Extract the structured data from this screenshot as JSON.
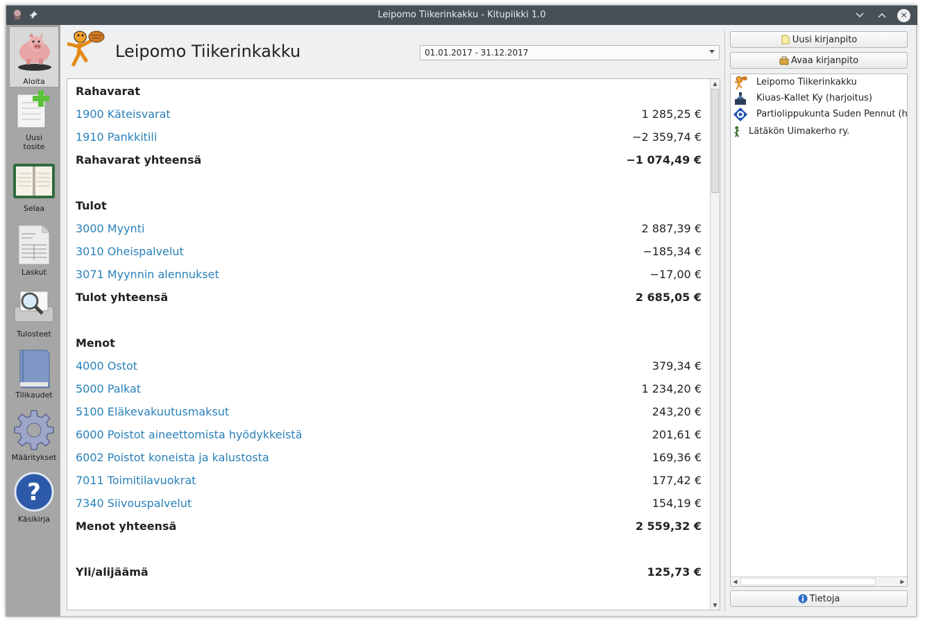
{
  "window": {
    "title": "Leipomo Tiikerinkakku - Kitupiikki 1.0"
  },
  "sidebar": {
    "items": [
      {
        "label": "Aloita",
        "icon": "piggy-bank-icon"
      },
      {
        "label": "Uusi\ntosite",
        "icon": "new-voucher-icon"
      },
      {
        "label": "Selaa",
        "icon": "calendar-book-icon"
      },
      {
        "label": "Laskut",
        "icon": "invoice-icon"
      },
      {
        "label": "Tulosteet",
        "icon": "print-preview-icon"
      },
      {
        "label": "Tilikaudet",
        "icon": "book-icon"
      },
      {
        "label": "Määritykset",
        "icon": "gear-icon"
      },
      {
        "label": "Käsikirja",
        "icon": "help-icon"
      }
    ]
  },
  "header": {
    "company": "Leipomo Tiikerinkakku",
    "period": "01.01.2017 - 31.12.2017"
  },
  "report": {
    "rows": [
      {
        "type": "section",
        "name": "Rahavarat",
        "amount": ""
      },
      {
        "type": "account",
        "name": "1900 Käteisvarat",
        "amount": "1 285,25 €"
      },
      {
        "type": "account",
        "name": "1910 Pankkitili",
        "amount": "−2 359,74 €"
      },
      {
        "type": "total",
        "name": "Rahavarat yhteensä",
        "amount": "−1 074,49 €"
      },
      {
        "type": "section",
        "name": "Tulot",
        "amount": ""
      },
      {
        "type": "account",
        "name": "3000 Myynti",
        "amount": "2 887,39 €"
      },
      {
        "type": "account",
        "name": "3010 Oheispalvelut",
        "amount": "−185,34 €"
      },
      {
        "type": "account",
        "name": "3071 Myynnin alennukset",
        "amount": "−17,00 €"
      },
      {
        "type": "total",
        "name": "Tulot yhteensä",
        "amount": "2 685,05 €"
      },
      {
        "type": "section",
        "name": "Menot",
        "amount": ""
      },
      {
        "type": "account",
        "name": "4000 Ostot",
        "amount": "379,34 €"
      },
      {
        "type": "account",
        "name": "5000 Palkat",
        "amount": "1 234,20 €"
      },
      {
        "type": "account",
        "name": "5100 Eläkevakuutusmaksut",
        "amount": "243,20 €"
      },
      {
        "type": "account",
        "name": "6000 Poistot aineettomista hyödykkeistä",
        "amount": "201,61 €"
      },
      {
        "type": "account",
        "name": "6002 Poistot koneista ja kalustosta",
        "amount": "169,36 €"
      },
      {
        "type": "account",
        "name": "7011 Toimitilavuokrat",
        "amount": "177,42 €"
      },
      {
        "type": "account",
        "name": "7340 Siivouspalvelut",
        "amount": "154,19 €"
      },
      {
        "type": "total",
        "name": "Menot yhteensä",
        "amount": "2 559,32 €"
      },
      {
        "type": "total",
        "name": "Yli/alijäämä",
        "amount": "125,73 €"
      }
    ]
  },
  "right_panel": {
    "new_button": "Uusi kirjanpito",
    "open_button": "Avaa kirjanpito",
    "info_button": "Tietoja",
    "recent": [
      {
        "name": "Leipomo Tiikerinkakku",
        "icon": "tiger-icon"
      },
      {
        "name": "Kiuas-Kallet Ky (harjoitus)",
        "icon": "sauna-stove-icon"
      },
      {
        "name": "Partiolippukunta Suden Pennut (harjoitus)",
        "icon": "scout-emblem-icon"
      },
      {
        "name": "Lätäkön Uimakerho ry.",
        "icon": "swimmer-icon"
      }
    ]
  },
  "colors": {
    "accent_link": "#2980b9",
    "titlebar": "#475057",
    "sidebar": "#a6a6a6"
  }
}
